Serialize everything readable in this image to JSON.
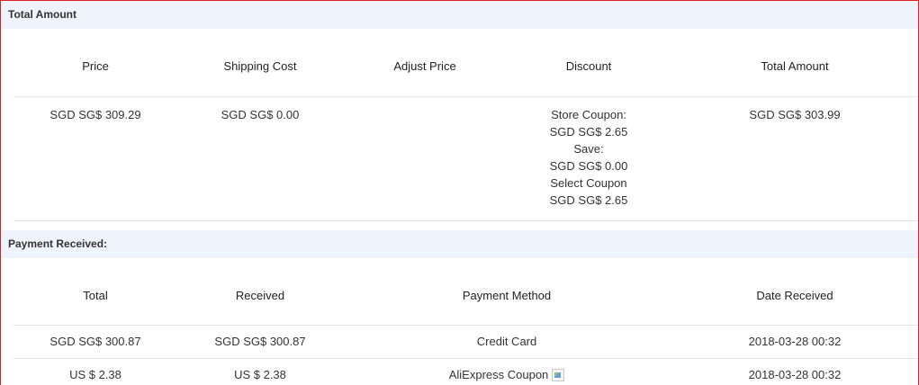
{
  "total_amount": {
    "header": "Total Amount",
    "columns": [
      "Price",
      "Shipping Cost",
      "Adjust Price",
      "Discount",
      "Total Amount"
    ],
    "row": {
      "price": "SGD SG$ 309.29",
      "shipping": "SGD SG$ 0.00",
      "adjust": "",
      "discount_lines": [
        "Store Coupon:",
        "SGD SG$ 2.65",
        "Save:",
        "SGD SG$ 0.00",
        "Select Coupon",
        "SGD SG$ 2.65"
      ],
      "total": "SGD SG$ 303.99"
    }
  },
  "payment_received": {
    "header": "Payment Received:",
    "columns": [
      "Total",
      "Received",
      "Payment Method",
      "Date Received"
    ],
    "rows": [
      {
        "total": "SGD SG$ 300.87",
        "received": "SGD SG$ 300.87",
        "method": "Credit Card",
        "date": "2018-03-28 00:32"
      },
      {
        "total": "US $ 2.38",
        "received": "US $ 2.38",
        "method": "AliExpress Coupon",
        "date": "2018-03-28 00:32",
        "method_icon": "broken-image-icon"
      }
    ]
  }
}
